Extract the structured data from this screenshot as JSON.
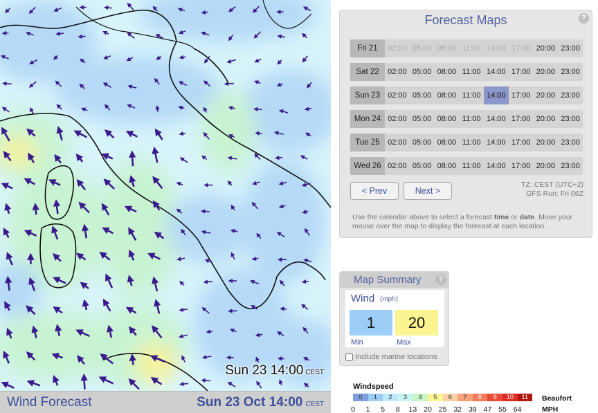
{
  "map": {
    "time_label": "Sun 23 14:00",
    "time_tz": "CEST"
  },
  "footer": {
    "title": "Wind Forecast",
    "date": "Sun 23 Oct 14:00",
    "tz": "CEST"
  },
  "forecast": {
    "title": "Forecast Maps",
    "help": "?",
    "rows": [
      {
        "day": "Fri 21",
        "slots": [
          "02:00",
          "05:00",
          "08:00",
          "11:00",
          "14:00",
          "17:00",
          "20:00",
          "23:00"
        ],
        "disabled": [
          0,
          1,
          2,
          3,
          4,
          5
        ]
      },
      {
        "day": "Sat 22",
        "slots": [
          "02:00",
          "05:00",
          "08:00",
          "11:00",
          "14:00",
          "17:00",
          "20:00",
          "23:00"
        ],
        "disabled": []
      },
      {
        "day": "Sun 23",
        "slots": [
          "02:00",
          "05:00",
          "08:00",
          "11:00",
          "14:00",
          "17:00",
          "20:00",
          "23:00"
        ],
        "disabled": [],
        "active": 4
      },
      {
        "day": "Mon 24",
        "slots": [
          "02:00",
          "05:00",
          "08:00",
          "11:00",
          "14:00",
          "17:00",
          "20:00",
          "23:00"
        ],
        "disabled": []
      },
      {
        "day": "Tue 25",
        "slots": [
          "02:00",
          "05:00",
          "08:00",
          "11:00",
          "14:00",
          "17:00",
          "20:00",
          "23:00"
        ],
        "disabled": []
      },
      {
        "day": "Wed 26",
        "slots": [
          "02:00",
          "05:00",
          "08:00",
          "11:00",
          "14:00",
          "17:00",
          "20:00",
          "23:00"
        ],
        "disabled": []
      }
    ],
    "prev_label": "< Prev",
    "next_label": "Next >",
    "tz_info": "TZ: CEST (UTC+2)",
    "run_info": "GFS Run: Fri 06Z",
    "instr_1": "Use the calendar above to select a forecast ",
    "instr_time": "time",
    "instr_2": " or ",
    "instr_date": "date",
    "instr_3": ". Move your mouse over the map to display the forecast at each location."
  },
  "summary": {
    "title": "Map Summary",
    "help": "?",
    "wind_label": "Wind",
    "wind_unit": "(mph)",
    "min_value": "1",
    "max_value": "20",
    "min_label": "Min",
    "max_label": "Max",
    "marine_label": "Include marine locations"
  },
  "legend": {
    "title": "Windspeed",
    "beaufort": [
      "0",
      "1",
      "2",
      "3",
      "4",
      "5",
      "6",
      "7",
      "8",
      "9",
      "10",
      "11"
    ],
    "beaufort_colors": [
      "#7f9fe0",
      "#9ccdf6",
      "#bfe8fa",
      "#c5f6f0",
      "#c6f5c6",
      "#fbf491",
      "#fbd0a6",
      "#f6a07c",
      "#f07b5c",
      "#ea4b36",
      "#dd2b22",
      "#b0160f"
    ],
    "beaufort_label": "Beaufort",
    "mph": [
      "0",
      "1",
      "5",
      "8",
      "13",
      "20",
      "25",
      "32",
      "39",
      "47",
      "55",
      "64"
    ],
    "mph_label": "MPH"
  },
  "colors": {
    "accent": "#3d4f9a",
    "arrow": "#3a1a8c"
  }
}
